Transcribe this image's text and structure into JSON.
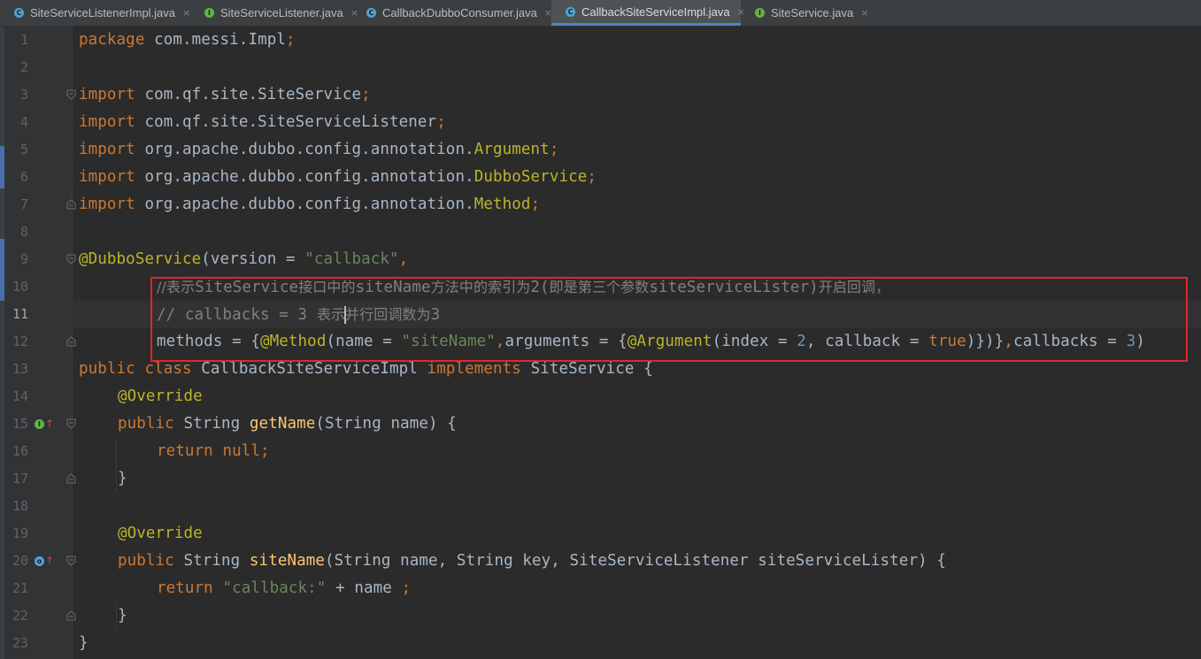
{
  "tabs": [
    {
      "label": "SiteServiceListenerImpl.java",
      "icon": "class-icon",
      "active": false
    },
    {
      "label": "SiteServiceListener.java",
      "icon": "interface-icon",
      "active": false
    },
    {
      "label": "CallbackDubboConsumer.java",
      "icon": "class-icon",
      "active": false
    },
    {
      "label": "CallbackSiteServiceImpl.java",
      "icon": "class-icon",
      "active": true
    },
    {
      "label": "SiteService.java",
      "icon": "interface-icon",
      "active": false
    }
  ],
  "tab_close_glyph": "×",
  "colors": {
    "background": "#2b2b2b",
    "gutter": "#313335",
    "keyword": "#cc7832",
    "annotation": "#bbb529",
    "string": "#6a8759",
    "number": "#6897bb",
    "comment": "#808080",
    "method": "#ffc66d",
    "highlight_box": "#e2262b",
    "active_tab_underline": "#4a88c7"
  },
  "editor": {
    "current_line": 11,
    "line_numbers": [
      "1",
      "2",
      "3",
      "4",
      "5",
      "6",
      "7",
      "8",
      "9",
      "10",
      "11",
      "12",
      "13",
      "14",
      "15",
      "16",
      "17",
      "18",
      "19",
      "20",
      "21",
      "22",
      "23"
    ],
    "code": {
      "l1": {
        "kw": "package",
        "rest": " com.messi.Impl",
        "semi": ";"
      },
      "l3": {
        "kw": "import",
        "pkg": " com.qf.site.SiteService",
        "semi": ";"
      },
      "l4": {
        "kw": "import",
        "pkg": " com.qf.site.SiteServiceListener",
        "semi": ";"
      },
      "l5": {
        "kw": "import",
        "pkg": " org.apache.dubbo.config.annotation.",
        "cls": "Argument",
        "semi": ";"
      },
      "l6": {
        "kw": "import",
        "pkg": " org.apache.dubbo.config.annotation.",
        "cls": "DubboService",
        "semi": ";"
      },
      "l7": {
        "kw": "import",
        "pkg": " org.apache.dubbo.config.annotation.",
        "cls": "Method",
        "semi": ";"
      },
      "l9": {
        "ann": "@DubboService",
        "open": "(version = ",
        "str": "\"callback\"",
        "comma": ","
      },
      "l10": {
        "p1": "//表示",
        "p2": "SiteService",
        "p3": "接口中的",
        "p4": "siteName",
        "p5": "方法中的索引为",
        "p6": "2(",
        "p7": "即是第三个参数",
        "p8": "siteServiceLister)",
        "p9": "开启回调，"
      },
      "l11": {
        "a": "// callbacks = 3 ",
        "b": "表示",
        "c": "并行回调数为",
        "d": "3"
      },
      "l12": {
        "a": "methods = {",
        "b": "@Method",
        "c": "(name = ",
        "d": "\"siteName\"",
        "e": ",",
        "f": "arguments = {",
        "g": "@Argument",
        "h": "(index = ",
        "i": "2",
        "j": ", callback = ",
        "k": "true",
        "l": ")})}",
        "m": ",",
        "n": "callbacks = ",
        "o": "3",
        "p": ")"
      },
      "l13": {
        "kw1": "public",
        "kw2": " class ",
        "name": "CallbackSiteServiceImpl",
        "kw3": " implements ",
        "iface": "SiteService {"
      },
      "l14": {
        "ann": "@Override"
      },
      "l15": {
        "kw": "public",
        "type": " String ",
        "fn": "getName",
        "params": "(String name) {"
      },
      "l16": {
        "kw": "return",
        "val": " null",
        "semi": ";"
      },
      "l17": {
        "brace": "}"
      },
      "l19": {
        "ann": "@Override"
      },
      "l20": {
        "kw": "public",
        "type": " String ",
        "fn": "siteName",
        "params": "(String name, String key, SiteServiceListener siteServiceLister) {"
      },
      "l21": {
        "kw": "return",
        "str": " \"callback:\"",
        "rest": " + name ",
        "semi": ";"
      },
      "l22": {
        "brace": "}"
      },
      "l23": {
        "brace": "}"
      }
    },
    "gutter_icons": {
      "l15": {
        "name": "implements-method-icon",
        "glyph": "I",
        "arrow": "↑"
      },
      "l20": {
        "name": "implements-method-icon",
        "glyph": "o",
        "arrow": "↑"
      }
    }
  }
}
